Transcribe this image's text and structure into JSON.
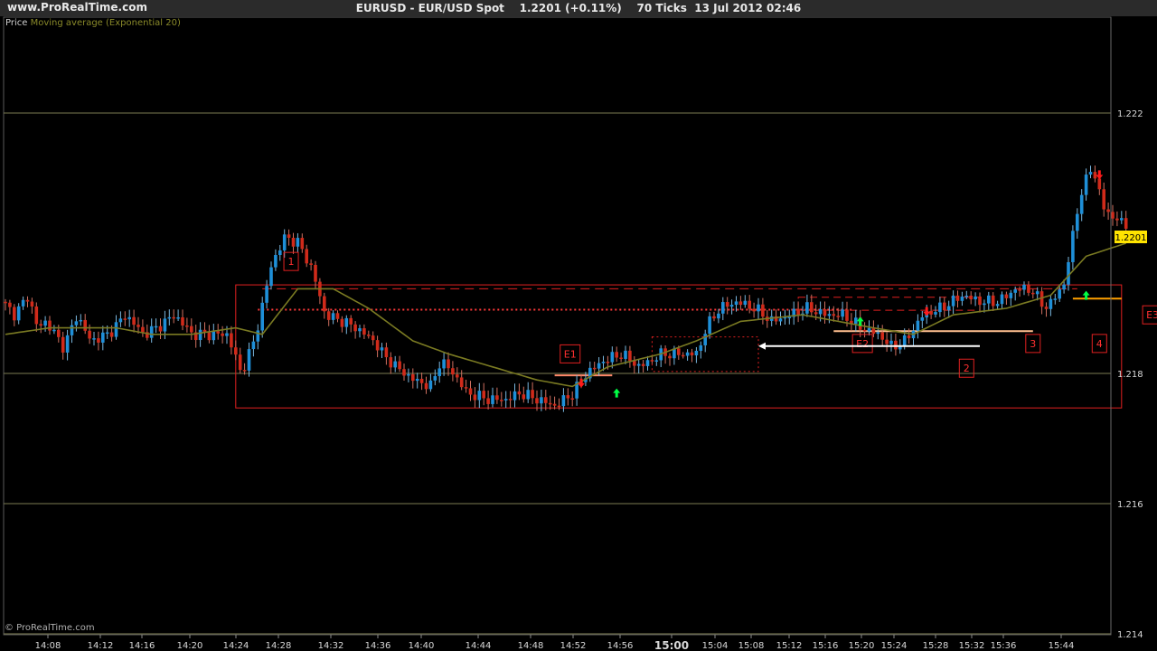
{
  "header": {
    "site": "www.ProRealTime.com",
    "symbol": "EURUSD - EUR/USD Spot",
    "price_text": "1.2201 (+0.11%)",
    "ticks": "70 Ticks",
    "datetime": "13 Jul 2012 02:46"
  },
  "legend": {
    "price_label": "Price",
    "ema_label": "Moving average (Exponential 20)"
  },
  "footer": {
    "copyright": "© ProRealTime.com"
  },
  "colors": {
    "bull": "#1e8fd8",
    "bear": "#d02a1a",
    "ema": "#7a7a22",
    "grid": "#7c7c52",
    "annotation": "#e02020",
    "last_price_bg": "#ffe400",
    "arrow_up": "#00ff44",
    "arrow_down": "#ff1a1a"
  },
  "chart_data": {
    "type": "candlestick",
    "title": "EURUSD - EUR/USD Spot",
    "ylim": [
      1.2136,
      1.2238
    ],
    "y_ticks": [
      "1.222",
      "1.218",
      "1.216",
      "1.214"
    ],
    "y_tick_values": [
      1.222,
      1.218,
      1.216,
      1.214
    ],
    "x_ticks": [
      "14:08",
      "14:12",
      "14:16",
      "14:20",
      "14:24",
      "14:28",
      "14:32",
      "14:36",
      "14:40",
      "14:44",
      "14:48",
      "14:52",
      "14:56",
      "15:00",
      "15:04",
      "15:08",
      "15:12",
      "15:16",
      "15:20",
      "15:24",
      "15:28",
      "15:32",
      "15:36",
      "15:44"
    ],
    "x_tick_bold": "15:00",
    "last_price": "1.2201",
    "grid": true,
    "price_anchors": [
      [
        0,
        1.2191
      ],
      [
        3,
        1.2189
      ],
      [
        6,
        1.2192
      ],
      [
        8,
        1.2187
      ],
      [
        10,
        1.2188
      ],
      [
        14,
        1.2184
      ],
      [
        17,
        1.2189
      ],
      [
        20,
        1.2185
      ],
      [
        24,
        1.2186
      ],
      [
        28,
        1.2189
      ],
      [
        32,
        1.2186
      ],
      [
        35,
        1.2187
      ],
      [
        39,
        1.2189
      ],
      [
        43,
        1.2186
      ],
      [
        47,
        1.2186
      ],
      [
        51,
        1.2186
      ],
      [
        54,
        1.218
      ],
      [
        57,
        1.2185
      ],
      [
        61,
        1.2197
      ],
      [
        64,
        1.2201
      ],
      [
        67,
        1.22
      ],
      [
        70,
        1.2196
      ],
      [
        73,
        1.2189
      ],
      [
        77,
        1.2188
      ],
      [
        80,
        1.2187
      ],
      [
        84,
        1.2185
      ],
      [
        86,
        1.2183
      ],
      [
        89,
        1.2181
      ],
      [
        93,
        1.2179
      ],
      [
        97,
        1.2178
      ],
      [
        99,
        1.2182
      ],
      [
        102,
        1.218
      ],
      [
        105,
        1.2177
      ],
      [
        110,
        1.2176
      ],
      [
        114,
        1.2176
      ],
      [
        117,
        1.2177
      ],
      [
        121,
        1.2176
      ],
      [
        125,
        1.2175
      ],
      [
        129,
        1.2177
      ],
      [
        132,
        1.218
      ],
      [
        136,
        1.2182
      ],
      [
        140,
        1.2183
      ],
      [
        144,
        1.2181
      ],
      [
        149,
        1.2183
      ],
      [
        153,
        1.2183
      ],
      [
        157,
        1.2183
      ],
      [
        159,
        1.2187
      ],
      [
        162,
        1.219
      ],
      [
        166,
        1.2191
      ],
      [
        170,
        1.219
      ],
      [
        174,
        1.2188
      ],
      [
        178,
        1.2189
      ],
      [
        182,
        1.219
      ],
      [
        186,
        1.2189
      ],
      [
        190,
        1.2189
      ],
      [
        194,
        1.2187
      ],
      [
        198,
        1.2186
      ],
      [
        201,
        1.2184
      ],
      [
        204,
        1.2185
      ],
      [
        208,
        1.2189
      ],
      [
        212,
        1.219
      ],
      [
        217,
        1.2192
      ],
      [
        221,
        1.2191
      ],
      [
        225,
        1.2191
      ],
      [
        229,
        1.2193
      ],
      [
        232,
        1.2193
      ],
      [
        236,
        1.219
      ],
      [
        240,
        1.2194
      ],
      [
        243,
        1.2206
      ],
      [
        246,
        1.2212
      ],
      [
        249,
        1.2205
      ],
      [
        253,
        1.2203
      ]
    ],
    "ema_anchors": [
      [
        0,
        1.2186
      ],
      [
        10,
        1.2187
      ],
      [
        25,
        1.2187
      ],
      [
        33,
        1.2186
      ],
      [
        42,
        1.2186
      ],
      [
        52,
        1.2187
      ],
      [
        58,
        1.2186
      ],
      [
        66,
        1.2193
      ],
      [
        74,
        1.2193
      ],
      [
        82,
        1.219
      ],
      [
        92,
        1.2185
      ],
      [
        100,
        1.2183
      ],
      [
        110,
        1.2181
      ],
      [
        120,
        1.2179
      ],
      [
        128,
        1.2178
      ],
      [
        136,
        1.2181
      ],
      [
        148,
        1.2183
      ],
      [
        156,
        1.2185
      ],
      [
        166,
        1.2188
      ],
      [
        180,
        1.2189
      ],
      [
        196,
        1.2187
      ],
      [
        205,
        1.2186
      ],
      [
        214,
        1.2189
      ],
      [
        226,
        1.219
      ],
      [
        236,
        1.2192
      ],
      [
        244,
        1.2198
      ],
      [
        253,
        1.22
      ]
    ],
    "rectangles": [
      {
        "kind": "range-box",
        "x0": 52,
        "x1": 252,
        "y_top": 1.21936,
        "y_bottom": 1.21747,
        "style": "solid"
      },
      {
        "kind": "resistance",
        "x0": 58,
        "x1": 242,
        "y_top": 1.2193,
        "y_bottom": 1.2193,
        "style": "dashed"
      },
      {
        "kind": "box-mid",
        "x0": 146,
        "x1": 170,
        "y_top": 1.21856,
        "y_bottom": 1.21803,
        "style": "dotted"
      },
      {
        "kind": "box-right",
        "x0": 179,
        "x1": 220,
        "y_top": 1.21917,
        "y_bottom": 1.21897,
        "style": "dashed"
      }
    ],
    "lines": [
      {
        "kind": "dotted-level",
        "x0": 57,
        "x1": 191,
        "y": 1.21898,
        "color": "#ff3a3a",
        "style": "dotted"
      },
      {
        "kind": "e1-level",
        "x0": 124,
        "x1": 137,
        "y": 1.21797,
        "color": "#ff8a6a",
        "style": "solid"
      },
      {
        "kind": "e2-level",
        "x0": 187,
        "x1": 232,
        "y": 1.21865,
        "color": "#ffc090",
        "style": "solid"
      },
      {
        "kind": "e3-level",
        "x0": 241,
        "x1": 252,
        "y": 1.21915,
        "color": "#ffa000",
        "style": "solid"
      }
    ],
    "white_arrow": {
      "x_tail": 220,
      "x_head": 170,
      "y": 1.21842
    },
    "labels": [
      {
        "text": "1",
        "x": 64.5,
        "y": 1.21972
      },
      {
        "text": "E1",
        "x": 127.5,
        "y": 1.2183
      },
      {
        "text": "E2",
        "x": 193.5,
        "y": 1.21846
      },
      {
        "text": "2",
        "x": 217,
        "y": 1.21808
      },
      {
        "text": "3",
        "x": 232,
        "y": 1.21846
      },
      {
        "text": "4",
        "x": 247,
        "y": 1.21846
      },
      {
        "text": "E3",
        "x": 259,
        "y": 1.2189
      }
    ],
    "signals": [
      {
        "dir": "down",
        "x": 130,
        "y": 1.21785
      },
      {
        "dir": "up",
        "x": 138,
        "y": 1.2177
      },
      {
        "dir": "up",
        "x": 193,
        "y": 1.2188
      },
      {
        "dir": "down",
        "x": 208,
        "y": 1.21895
      },
      {
        "dir": "up",
        "x": 244,
        "y": 1.2192
      },
      {
        "dir": "down",
        "x": 247,
        "y": 1.22105
      }
    ]
  }
}
